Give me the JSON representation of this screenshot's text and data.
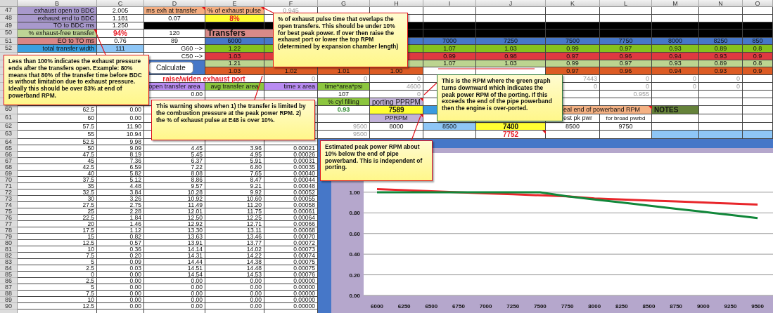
{
  "sheet": {
    "columns": [
      "B",
      "C",
      "D",
      "E",
      "F",
      "G",
      "H",
      "I",
      "J",
      "K",
      "L",
      "M",
      "N",
      "O"
    ],
    "rows": [
      {
        "number": "47",
        "cells": [
          {
            "text": "exhaust open to BDC",
            "kind": "label",
            "color": "#a899cc"
          },
          {
            "text": "2.005",
            "kind": "value"
          },
          {
            "text": "ms exh at transfer",
            "kind": "text",
            "color": "#f4ae82",
            "note": true
          },
          {
            "text": "% of exhaust pulse",
            "kind": "text",
            "color": "#f4ae82",
            "note": true
          },
          {
            "text": "0.945",
            "kind": "faint"
          }
        ]
      },
      {
        "number": "48",
        "cells": [
          {
            "text": "exhaust end to BDC",
            "kind": "label",
            "color": "#a899cc"
          },
          {
            "text": "1.181",
            "kind": "value"
          },
          {
            "text": "0.07",
            "kind": "value"
          },
          {
            "text": "8%",
            "kind": "alert",
            "color": "#ffff33"
          }
        ]
      },
      {
        "number": "49",
        "cells": [
          {
            "text": "TO to BDC ms",
            "kind": "label",
            "color": "#a899cc"
          },
          {
            "text": "1.250",
            "kind": "value"
          },
          {
            "kind": "blank",
            "color": "#000000"
          },
          {
            "kind": "blank",
            "color": "#000000"
          },
          {
            "kind": "blank",
            "color": "#000000"
          },
          "",
          {
            "kind": "blank",
            "color": "#000000"
          },
          {
            "kind": "blank",
            "color": "#000000"
          },
          {
            "kind": "blank",
            "color": "#000000"
          },
          {
            "kind": "blank",
            "color": "#000000"
          },
          {
            "kind": "blank",
            "color": "#000000"
          },
          {
            "kind": "blank",
            "color": "#000000"
          },
          {
            "kind": "blank",
            "color": "#000000"
          },
          {
            "kind": "blank",
            "color": "#000000"
          }
        ]
      },
      {
        "number": "50",
        "cells": [
          {
            "text": "% exhaust-free transfer",
            "kind": "label",
            "color": "#bdd495",
            "note": true
          },
          {
            "text": "94%",
            "kind": "alert"
          },
          {
            "text": "120",
            "kind": "value"
          },
          {
            "text": "Transfers",
            "kind": "title",
            "color": "#d98a88"
          },
          {
            "kind": "merged"
          },
          "",
          {
            "kind": "blank",
            "color": "#000000"
          },
          {
            "kind": "blank",
            "color": "#000000"
          },
          {
            "kind": "blank",
            "color": "#000000"
          },
          {
            "kind": "blank",
            "color": "#000000"
          },
          {
            "kind": "blank",
            "color": "#000000"
          },
          {
            "kind": "blank",
            "color": "#000000"
          },
          {
            "kind": "blank",
            "color": "#000000"
          },
          {
            "kind": "blank",
            "color": "#000000"
          }
        ]
      },
      {
        "number": "51",
        "cells": [
          {
            "text": "EO to TO ms",
            "kind": "label",
            "color": "#d98686"
          },
          {
            "text": "0.76",
            "kind": "value"
          },
          {
            "text": "89",
            "kind": "value"
          },
          {
            "text": "6000",
            "kind": "value",
            "color": "#4677c8"
          },
          {
            "kind": "blank",
            "color": "#4677c8"
          },
          "",
          {
            "kind": "blank",
            "color": "#4677c8"
          },
          {
            "text": "7000",
            "kind": "value",
            "color": "#4677c8"
          },
          {
            "text": "7250",
            "kind": "value",
            "color": "#4677c8"
          },
          {
            "text": "7500",
            "kind": "value",
            "color": "#4677c8"
          },
          {
            "text": "7750",
            "kind": "value",
            "color": "#4677c8"
          },
          {
            "text": "8000",
            "kind": "value",
            "color": "#4677c8"
          },
          {
            "text": "8250",
            "kind": "value",
            "color": "#4677c8"
          },
          {
            "text": "850",
            "kind": "value",
            "color": "#4677c8"
          }
        ]
      },
      {
        "number": "52",
        "cells": [
          {
            "text": "total transfer width",
            "kind": "label",
            "color": "#3aa0e0"
          },
          {
            "text": "111",
            "kind": "value",
            "color": "#8ec6f6"
          },
          {
            "text": "G60 -->",
            "kind": "label"
          },
          {
            "text": "1.22",
            "kind": "value",
            "color": "#85c21e"
          },
          {
            "kind": "blank",
            "color": "#85c21e"
          },
          "",
          {
            "kind": "blank",
            "color": "#85c21e"
          },
          {
            "text": "1.07",
            "kind": "value",
            "color": "#85c21e"
          },
          {
            "text": "1.03",
            "kind": "value",
            "color": "#85c21e"
          },
          {
            "text": "0.99",
            "kind": "value",
            "color": "#85c21e"
          },
          {
            "text": "0.97",
            "kind": "value",
            "color": "#85c21e"
          },
          {
            "text": "0.93",
            "kind": "value",
            "color": "#85c21e"
          },
          {
            "text": "0.89",
            "kind": "value",
            "color": "#85c21e"
          },
          {
            "text": "0.8",
            "kind": "value",
            "color": "#85c21e"
          }
        ]
      },
      {
        "cells": [
          "",
          "",
          {
            "text": "C50 -->",
            "kind": "label"
          },
          {
            "text": "1.03",
            "kind": "value",
            "color": "#df3941"
          },
          {
            "kind": "blank",
            "color": "#df3941"
          },
          "",
          {
            "kind": "blank",
            "color": "#df3941"
          },
          {
            "text": "0.99",
            "kind": "value",
            "color": "#df3941"
          },
          {
            "text": "0.98",
            "kind": "value",
            "color": "#df3941"
          },
          {
            "text": "0.97",
            "kind": "value",
            "color": "#df3941"
          },
          {
            "text": "0.96",
            "kind": "value",
            "color": "#df3941"
          },
          {
            "text": "0.94",
            "kind": "value",
            "color": "#df3941"
          },
          {
            "text": "0.93",
            "kind": "value",
            "color": "#df3941"
          },
          {
            "text": "0.9",
            "kind": "value",
            "color": "#df3941"
          }
        ]
      },
      {
        "cells": [
          "",
          "",
          {
            "text": "Calculate",
            "kind": "button",
            "color": "#4677c8"
          },
          {
            "text": "1.21",
            "kind": "value",
            "color": "#bcd490"
          },
          {
            "kind": "blank",
            "color": "#bcd490"
          },
          "",
          {
            "kind": "blank",
            "color": "#bcd490"
          },
          {
            "text": "1.07",
            "kind": "value",
            "color": "#bcd490"
          },
          {
            "text": "1.03",
            "kind": "value",
            "color": "#bcd490"
          },
          {
            "text": "0.99",
            "kind": "value",
            "color": "#bcd490"
          },
          {
            "text": "0.97",
            "kind": "value",
            "color": "#bcd490"
          },
          {
            "text": "0.93",
            "kind": "value",
            "color": "#bcd490"
          },
          {
            "text": "0.89",
            "kind": "value",
            "color": "#bcd490"
          },
          {
            "text": "0.8",
            "kind": "value",
            "color": "#bcd490"
          }
        ]
      },
      {
        "cells": [
          "",
          "",
          {
            "kind": "merged-above"
          },
          {
            "text": "1.03",
            "kind": "value",
            "color": "#dc5b24"
          },
          {
            "text": "1.02",
            "kind": "value",
            "color": "#dc5b24"
          },
          {
            "text": "1.01",
            "kind": "value",
            "color": "#dc5b24"
          },
          {
            "text": "1.00",
            "kind": "value",
            "color": "#dc5b24"
          },
          "",
          "",
          {
            "text": "0.97",
            "kind": "value",
            "color": "#dc5b24"
          },
          {
            "text": "0.96",
            "kind": "value",
            "color": "#dc5b24"
          },
          {
            "text": "0.94",
            "kind": "value",
            "color": "#dc5b24"
          },
          {
            "text": "0.93",
            "kind": "value",
            "color": "#dc5b24"
          },
          {
            "text": "0.9",
            "kind": "value",
            "color": "#dc5b24"
          }
        ]
      },
      {
        "cells": [
          "",
          "",
          {
            "text": "raise/widen exhaust port",
            "kind": "alert"
          },
          {
            "kind": "merged"
          },
          {
            "text": "0",
            "kind": "muted"
          },
          {
            "text": "0",
            "kind": "muted"
          },
          {
            "text": "0",
            "kind": "muted"
          },
          "",
          "",
          {
            "text": "7443",
            "kind": "muted"
          },
          {
            "text": "0",
            "kind": "muted"
          },
          {
            "text": "0",
            "kind": "muted"
          },
          {
            "text": "0",
            "kind": "muted"
          }
        ]
      },
      {
        "cells": [
          "",
          "",
          {
            "text": "open transfer area",
            "kind": "value",
            "color": "#b98cf2"
          },
          {
            "text": "avg transfer area",
            "kind": "value",
            "color": "#8cc63f"
          },
          {
            "text": "time x area",
            "kind": "label",
            "color": "#b98cf2"
          },
          {
            "text": "time*area*psi",
            "kind": "value",
            "color": "#8cc63f"
          },
          {
            "text": "4600",
            "kind": "muted"
          },
          "",
          "",
          {
            "text": "0",
            "kind": "muted"
          },
          {
            "text": "0",
            "kind": "muted"
          },
          {
            "text": "0",
            "kind": "muted"
          },
          {
            "text": "0",
            "kind": "muted"
          }
        ]
      },
      {
        "cells": [
          "",
          "",
          {
            "text": "0.00",
            "kind": "number"
          },
          "",
          "",
          {
            "text": "107",
            "kind": "value"
          },
          {
            "text": "0",
            "kind": "muted"
          },
          "",
          "",
          "",
          {
            "text": "0.955",
            "kind": "muted"
          }
        ]
      },
      {
        "cells": [
          "",
          "",
          "",
          "",
          "",
          {
            "text": "% cyl filling",
            "kind": "value",
            "color": "#8cc63f"
          },
          {
            "text": "porting PPRPM",
            "kind": "large",
            "color": "#c2b2d8",
            "note": true
          }
        ]
      },
      {
        "number": "60",
        "cells": [
          {
            "text": "62.5",
            "kind": "number"
          },
          {
            "text": "0.00",
            "kind": "number"
          },
          "",
          "",
          "",
          {
            "text": "0.93",
            "kind": "good"
          },
          {
            "text": "7589",
            "kind": "strong",
            "color": "#ffff33"
          },
          {
            "kind": "blank",
            "color": "#3a9ae0"
          },
          "",
          {
            "text": "eal end of powerband RPM",
            "kind": "partial",
            "color": "#f4b183",
            "note": true
          },
          {
            "kind": "merged"
          },
          {
            "text": "NOTES",
            "kind": "heading",
            "color": "#65823a"
          }
        ]
      },
      {
        "number": "61",
        "cells": [
          {
            "text": "60",
            "kind": "number"
          },
          {
            "text": "0.00",
            "kind": "number"
          },
          "",
          "",
          "",
          "",
          {
            "text": "PPRPM",
            "kind": "value",
            "color": "#c2b2d8",
            "note": true
          },
          "",
          "",
          {
            "text": "est pk pwr",
            "kind": "partial"
          },
          {
            "text": "for broad pwrbd",
            "kind": "small"
          }
        ]
      },
      {
        "number": "62",
        "cells": [
          {
            "text": "57.5",
            "kind": "number"
          },
          {
            "text": "11.90",
            "kind": "number"
          },
          "",
          "",
          "",
          {
            "text": "9500",
            "kind": "muted"
          },
          {
            "text": "8000",
            "kind": "value"
          },
          {
            "text": "8500",
            "kind": "value",
            "color": "#8ec6f6"
          },
          {
            "text": "7400",
            "kind": "strong",
            "color": "#ffff33"
          },
          {
            "text": "8500",
            "kind": "value"
          },
          {
            "text": "9750",
            "kind": "value"
          }
        ]
      },
      {
        "number": "63",
        "cells": [
          {
            "text": "55",
            "kind": "number"
          },
          {
            "text": "10.94",
            "kind": "number"
          },
          "",
          "",
          "",
          {
            "text": "9500",
            "kind": "muted"
          },
          "",
          "",
          {
            "text": "7752",
            "kind": "alert",
            "note": true
          },
          "",
          "",
          {
            "kind": "blank",
            "color": "#8ec6f6"
          },
          {
            "kind": "blank",
            "color": "#8ec6f6"
          },
          {
            "kind": "blank",
            "color": "#8ec6f6"
          }
        ]
      },
      {
        "number": "64",
        "cells": [
          {
            "text": "52.5",
            "kind": "number"
          },
          {
            "text": "9.98",
            "kind": "number"
          }
        ]
      },
      {
        "number": "65",
        "cells": [
          {
            "text": "50",
            "kind": "number"
          },
          {
            "text": "9.09",
            "kind": "number"
          },
          {
            "text": "4.45",
            "kind": "number"
          },
          {
            "text": "3.96",
            "kind": "number"
          },
          {
            "text": "0.00021",
            "kind": "number"
          }
        ]
      },
      {
        "number": "66",
        "cells": [
          {
            "text": "47.5",
            "kind": "number"
          },
          {
            "text": "8.19",
            "kind": "number"
          },
          {
            "text": "5.45",
            "kind": "number"
          },
          {
            "text": "4.95",
            "kind": "number"
          },
          {
            "text": "0.00026",
            "kind": "number"
          }
        ]
      },
      {
        "number": "67",
        "cells": [
          {
            "text": "45",
            "kind": "number"
          },
          {
            "text": "7.36",
            "kind": "number"
          },
          {
            "text": "6.37",
            "kind": "number"
          },
          {
            "text": "5.91",
            "kind": "number"
          },
          {
            "text": "0.00031",
            "kind": "number"
          }
        ]
      },
      {
        "number": "68",
        "cells": [
          {
            "text": "42.5",
            "kind": "number"
          },
          {
            "text": "6.59",
            "kind": "number"
          },
          {
            "text": "7.22",
            "kind": "number"
          },
          {
            "text": "6.80",
            "kind": "number"
          },
          {
            "text": "0.00035",
            "kind": "number"
          }
        ]
      },
      {
        "number": "69",
        "cells": [
          {
            "text": "40",
            "kind": "number"
          },
          {
            "text": "5.82",
            "kind": "number"
          },
          {
            "text": "8.08",
            "kind": "number"
          },
          {
            "text": "7.65",
            "kind": "number"
          },
          {
            "text": "0.00040",
            "kind": "number"
          }
        ]
      },
      {
        "number": "70",
        "cells": [
          {
            "text": "37.5",
            "kind": "number"
          },
          {
            "text": "5.12",
            "kind": "number"
          },
          {
            "text": "8.86",
            "kind": "number"
          },
          {
            "text": "8.47",
            "kind": "number"
          },
          {
            "text": "0.00044",
            "kind": "number"
          }
        ]
      },
      {
        "number": "71",
        "cells": [
          {
            "text": "35",
            "kind": "number"
          },
          {
            "text": "4.48",
            "kind": "number"
          },
          {
            "text": "9.57",
            "kind": "number"
          },
          {
            "text": "9.21",
            "kind": "number"
          },
          {
            "text": "0.00048",
            "kind": "number"
          }
        ]
      },
      {
        "number": "72",
        "cells": [
          {
            "text": "32.5",
            "kind": "number"
          },
          {
            "text": "3.84",
            "kind": "number"
          },
          {
            "text": "10.28",
            "kind": "number"
          },
          {
            "text": "9.92",
            "kind": "number"
          },
          {
            "text": "0.00052",
            "kind": "number"
          }
        ]
      },
      {
        "number": "73",
        "cells": [
          {
            "text": "30",
            "kind": "number"
          },
          {
            "text": "3.26",
            "kind": "number"
          },
          {
            "text": "10.92",
            "kind": "number"
          },
          {
            "text": "10.60",
            "kind": "number"
          },
          {
            "text": "0.00055",
            "kind": "number"
          }
        ]
      },
      {
        "number": "74",
        "cells": [
          {
            "text": "27.5",
            "kind": "number"
          },
          {
            "text": "2.75",
            "kind": "number"
          },
          {
            "text": "11.49",
            "kind": "number"
          },
          {
            "text": "11.20",
            "kind": "number"
          },
          {
            "text": "0.00058",
            "kind": "number"
          }
        ]
      },
      {
        "number": "75",
        "cells": [
          {
            "text": "25",
            "kind": "number"
          },
          {
            "text": "2.28",
            "kind": "number"
          },
          {
            "text": "12.01",
            "kind": "number"
          },
          {
            "text": "11.75",
            "kind": "number"
          },
          {
            "text": "0.00061",
            "kind": "number"
          }
        ]
      },
      {
        "number": "76",
        "cells": [
          {
            "text": "22.5",
            "kind": "number"
          },
          {
            "text": "1.84",
            "kind": "number"
          },
          {
            "text": "12.50",
            "kind": "number"
          },
          {
            "text": "12.25",
            "kind": "number"
          },
          {
            "text": "0.00064",
            "kind": "number"
          }
        ]
      },
      {
        "number": "77",
        "cells": [
          {
            "text": "20",
            "kind": "number"
          },
          {
            "text": "1.46",
            "kind": "number"
          },
          {
            "text": "12.92",
            "kind": "number"
          },
          {
            "text": "12.71",
            "kind": "number"
          },
          {
            "text": "0.00066",
            "kind": "number"
          }
        ]
      },
      {
        "number": "78",
        "cells": [
          {
            "text": "17.5",
            "kind": "number"
          },
          {
            "text": "1.12",
            "kind": "number"
          },
          {
            "text": "13.30",
            "kind": "number"
          },
          {
            "text": "13.11",
            "kind": "number"
          },
          {
            "text": "0.00068",
            "kind": "number"
          }
        ]
      },
      {
        "number": "79",
        "cells": [
          {
            "text": "15",
            "kind": "number"
          },
          {
            "text": "0.82",
            "kind": "number"
          },
          {
            "text": "13.63",
            "kind": "number"
          },
          {
            "text": "13.46",
            "kind": "number"
          },
          {
            "text": "0.00070",
            "kind": "number"
          }
        ]
      },
      {
        "number": "80",
        "cells": [
          {
            "text": "12.5",
            "kind": "number"
          },
          {
            "text": "0.57",
            "kind": "number"
          },
          {
            "text": "13.91",
            "kind": "number"
          },
          {
            "text": "13.77",
            "kind": "number"
          },
          {
            "text": "0.00072",
            "kind": "number"
          }
        ]
      },
      {
        "number": "81",
        "cells": [
          {
            "text": "10",
            "kind": "number"
          },
          {
            "text": "0.36",
            "kind": "number"
          },
          {
            "text": "14.14",
            "kind": "number"
          },
          {
            "text": "14.02",
            "kind": "number"
          },
          {
            "text": "0.00073",
            "kind": "number"
          }
        ]
      },
      {
        "number": "82",
        "cells": [
          {
            "text": "7.5",
            "kind": "number"
          },
          {
            "text": "0.20",
            "kind": "number"
          },
          {
            "text": "14.31",
            "kind": "number"
          },
          {
            "text": "14.22",
            "kind": "number"
          },
          {
            "text": "0.00074",
            "kind": "number"
          }
        ]
      },
      {
        "number": "83",
        "cells": [
          {
            "text": "5",
            "kind": "number"
          },
          {
            "text": "0.09",
            "kind": "number"
          },
          {
            "text": "14.44",
            "kind": "number"
          },
          {
            "text": "14.38",
            "kind": "number"
          },
          {
            "text": "0.00075",
            "kind": "number"
          }
        ]
      },
      {
        "number": "84",
        "cells": [
          {
            "text": "2.5",
            "kind": "number"
          },
          {
            "text": "0.03",
            "kind": "number"
          },
          {
            "text": "14.51",
            "kind": "number"
          },
          {
            "text": "14.48",
            "kind": "number"
          },
          {
            "text": "0.00075",
            "kind": "number"
          }
        ]
      },
      {
        "number": "85",
        "cells": [
          {
            "text": "0",
            "kind": "number"
          },
          {
            "text": "0.00",
            "kind": "number"
          },
          {
            "text": "14.54",
            "kind": "number"
          },
          {
            "text": "14.53",
            "kind": "number"
          },
          {
            "text": "0.00076",
            "kind": "number"
          }
        ]
      },
      {
        "number": "86",
        "cells": [
          {
            "text": "2.5",
            "kind": "number"
          },
          {
            "text": "0.00",
            "kind": "number"
          },
          {
            "text": "0.00",
            "kind": "number"
          },
          {
            "text": "0.00",
            "kind": "number"
          },
          {
            "text": "0.00000",
            "kind": "number"
          }
        ]
      },
      {
        "number": "87",
        "cells": [
          {
            "text": "5",
            "kind": "number"
          },
          {
            "text": "0.00",
            "kind": "number"
          },
          {
            "text": "0.00",
            "kind": "number"
          },
          {
            "text": "0.00",
            "kind": "number"
          },
          {
            "text": "0.00000",
            "kind": "number"
          }
        ]
      },
      {
        "number": "88",
        "cells": [
          {
            "text": "7.5",
            "kind": "number"
          },
          {
            "text": "0.00",
            "kind": "number"
          },
          {
            "text": "0.00",
            "kind": "number"
          },
          {
            "text": "0.00",
            "kind": "number"
          },
          {
            "text": "0.00000",
            "kind": "number"
          }
        ]
      },
      {
        "number": "89",
        "cells": [
          {
            "text": "10",
            "kind": "number"
          },
          {
            "text": "0.00",
            "kind": "number"
          },
          {
            "text": "0.00",
            "kind": "number"
          },
          {
            "text": "0.00",
            "kind": "number"
          },
          {
            "text": "0.00000",
            "kind": "number"
          }
        ]
      },
      {
        "number": "90",
        "cells": [
          {
            "text": "12.5",
            "kind": "number"
          },
          {
            "text": "0.00",
            "kind": "number"
          },
          {
            "text": "0.00",
            "kind": "number"
          },
          {
            "text": "0.00",
            "kind": "number"
          },
          {
            "text": "0.00000",
            "kind": "number"
          }
        ]
      }
    ]
  },
  "chart": {
    "chart_data": {
      "type": "line",
      "grid": true,
      "categories": [
        "6000",
        "6250",
        "6500",
        "6750",
        "7000",
        "7250",
        "7500",
        "7750",
        "8000",
        "8250",
        "8500",
        "8750",
        "9000",
        "9250",
        "9500"
      ],
      "series": [
        {
          "color": "#e8262b",
          "values": [
            1.03,
            1.02,
            1.01,
            1.0,
            0.99,
            0.98,
            0.97,
            0.96,
            0.94,
            0.93,
            0.92,
            0.91,
            0.9,
            0.89,
            0.88
          ]
        },
        {
          "color": "#11873a",
          "values": [
            1.0,
            1.0,
            1.0,
            1.0,
            1.0,
            1.0,
            1.0,
            0.96,
            0.93,
            0.9,
            0.87,
            0.84,
            0.81,
            0.78,
            0.75
          ]
        }
      ],
      "ylim": [
        0,
        1.38
      ],
      "yticks": [
        {
          "value": 0,
          "label": "0.00"
        },
        {
          "value": 0.2,
          "label": "0.20"
        },
        {
          "value": 0.4,
          "label": "0.40"
        },
        {
          "value": 0.6,
          "label": "0.60"
        },
        {
          "value": 0.8,
          "label": "0.80"
        },
        {
          "value": 1.0,
          "label": "1.00"
        }
      ]
    }
  },
  "comments": [
    {
      "text": "Less than 100% indicates the exhaust pressure ends after the transfers open. Example: 80% means that 80% of the transfer time before BDC is without limitation due to exhaust pressure. Ideally this should be over 83% at end of powerband RPM.",
      "color": "#e0141c"
    },
    {
      "text": "% of exhaust pulse time that overlaps the open transfers. This should be under 10% for best peak power. If over then raise the exhaust port or lower the top RPM (determined by expansion chamber length)",
      "color": "#e0141c"
    },
    {
      "text": "This warning shows when 1) the transfer is limited by the combustion pressure at the peak power RPM. 2) the % of exhaust pulse at E48 is over 10%.",
      "color": "#e0141c"
    },
    {
      "text": "This is the RPM where the green graph turns downward which indicates the peak power RPM of the porting. If this exceeds the end of the pipe powerband then the engine is over-ported.",
      "color": "#2f7a3a"
    },
    {
      "text": "Estimated peak power RPM about 10% below the end of pipe powerband. This is independent of porting.",
      "color": "#e0141c"
    }
  ]
}
